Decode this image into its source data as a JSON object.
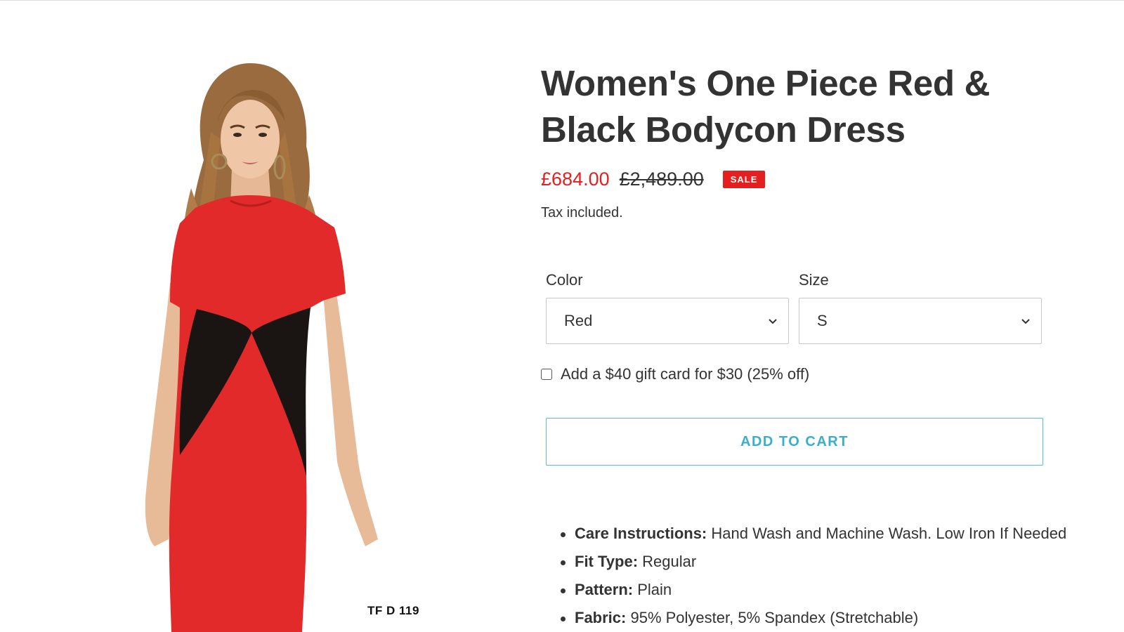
{
  "product": {
    "title": "Women's One Piece Red & Black Bodycon Dress",
    "sale_price": "£684.00",
    "regular_price": "£2,489.00",
    "badge": "SALE",
    "tax_note": "Tax included.",
    "image_code": "TF D 119",
    "colors": {
      "sale": "#e31f1f",
      "accent": "#3aaecf",
      "text": "#333333"
    }
  },
  "options": {
    "color": {
      "label": "Color",
      "value": "Red"
    },
    "size": {
      "label": "Size",
      "value": "S"
    }
  },
  "giftcard": {
    "label": "Add a $40 gift card for $30 (25% off)",
    "checked": false
  },
  "cart": {
    "button_label": "ADD TO CART"
  },
  "details": [
    {
      "key": "Care Instructions:",
      "value": "Hand Wash and Machine Wash. Low Iron If Needed"
    },
    {
      "key": "Fit Type:",
      "value": "Regular"
    },
    {
      "key": "Pattern:",
      "value": "Plain"
    },
    {
      "key": "Fabric:",
      "value": "95% Polyester, 5% Spandex (Stretchable)"
    }
  ],
  "icons": {
    "select_arrow": "chevron-down-icon"
  }
}
